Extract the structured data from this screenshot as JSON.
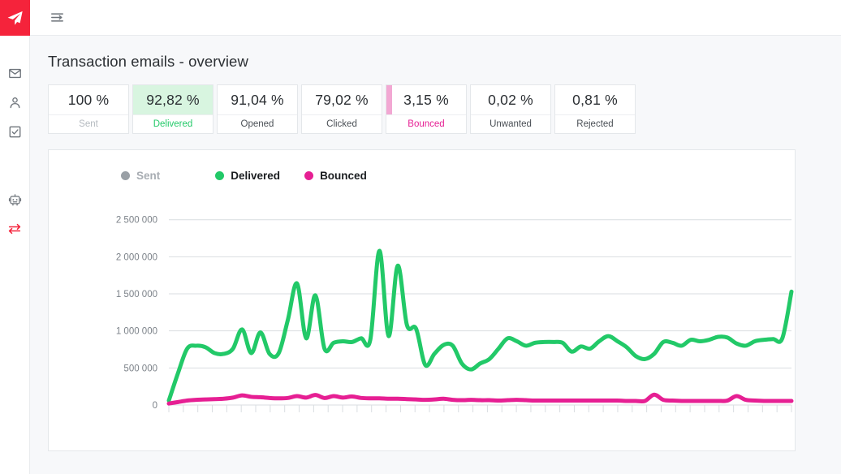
{
  "sidebar": {
    "logo_icon": "paper-plane-logo",
    "items": [
      {
        "icon": "envelope-icon",
        "name": "nav-campaigns",
        "active": false
      },
      {
        "icon": "user-icon",
        "name": "nav-contacts",
        "active": false
      },
      {
        "icon": "checkbox-list-icon",
        "name": "nav-tasks",
        "active": false
      },
      {
        "icon": "robot-icon",
        "name": "nav-automation",
        "active": false
      },
      {
        "icon": "transfer-arrows-icon",
        "name": "nav-transactional",
        "active": true
      }
    ]
  },
  "topbar": {
    "menu_icon": "hamburger-collapse-icon"
  },
  "header": {
    "title": "Transaction emails - overview"
  },
  "kpis": [
    {
      "value": "100 %",
      "label": "Sent",
      "state": "muted"
    },
    {
      "value": "92,82 %",
      "label": "Delivered",
      "state": "highlight-green"
    },
    {
      "value": "91,04 %",
      "label": "Opened",
      "state": "normal"
    },
    {
      "value": "79,02 %",
      "label": "Clicked",
      "state": "normal"
    },
    {
      "value": "3,15 %",
      "label": "Bounced",
      "state": "accent-pink"
    },
    {
      "value": "0,02 %",
      "label": "Unwanted",
      "state": "normal"
    },
    {
      "value": "0,81 %",
      "label": "Rejected",
      "state": "normal"
    }
  ],
  "colors": {
    "brand_red": "#F5233B",
    "green": "#22C968",
    "pink": "#E61F93",
    "grey": "#9AA0A6",
    "green_fill": "#D8F5E0",
    "pink_fill": "#F2A8D3"
  },
  "chart_data": {
    "type": "line",
    "title": "",
    "xlabel": "",
    "ylabel": "",
    "ylim": [
      0,
      2650000
    ],
    "yticks": [
      0,
      500000,
      1000000,
      1500000,
      2000000,
      2500000
    ],
    "ytick_labels": [
      "0",
      "500 000",
      "1 000 000",
      "1 500 000",
      "2 000 000",
      "2 500 000"
    ],
    "grid": true,
    "legend_position": "top-left",
    "x_axis_ticks_unlabeled": 44,
    "legend": [
      {
        "name": "Sent",
        "color": "#9AA0A6",
        "enabled": false
      },
      {
        "name": "Delivered",
        "color": "#22C968",
        "enabled": true
      },
      {
        "name": "Bounced",
        "color": "#E61F93",
        "enabled": true
      }
    ],
    "series": [
      {
        "name": "Delivered",
        "color": "#22C968",
        "values": [
          60000,
          430000,
          760000,
          800000,
          780000,
          700000,
          690000,
          760000,
          1020000,
          700000,
          980000,
          690000,
          700000,
          1150000,
          1640000,
          900000,
          1480000,
          760000,
          840000,
          860000,
          850000,
          900000,
          880000,
          2080000,
          930000,
          1880000,
          1080000,
          1030000,
          540000,
          690000,
          810000,
          800000,
          560000,
          480000,
          560000,
          620000,
          760000,
          900000,
          860000,
          800000,
          840000,
          850000,
          850000,
          840000,
          720000,
          790000,
          760000,
          860000,
          930000,
          860000,
          780000,
          660000,
          620000,
          690000,
          850000,
          840000,
          800000,
          880000,
          860000,
          880000,
          920000,
          910000,
          830000,
          800000,
          860000,
          880000,
          890000,
          900000,
          1530000
        ]
      },
      {
        "name": "Bounced",
        "color": "#E61F93",
        "values": [
          20000,
          40000,
          60000,
          70000,
          75000,
          80000,
          85000,
          100000,
          130000,
          110000,
          105000,
          95000,
          90000,
          95000,
          120000,
          100000,
          135000,
          95000,
          120000,
          100000,
          115000,
          95000,
          90000,
          90000,
          85000,
          85000,
          80000,
          75000,
          70000,
          75000,
          85000,
          70000,
          65000,
          70000,
          65000,
          65000,
          60000,
          65000,
          70000,
          65000,
          60000,
          60000,
          60000,
          60000,
          60000,
          60000,
          60000,
          60000,
          60000,
          60000,
          55000,
          55000,
          55000,
          140000,
          70000,
          60000,
          55000,
          55000,
          55000,
          55000,
          55000,
          60000,
          120000,
          70000,
          60000,
          55000,
          55000,
          55000,
          55000
        ]
      }
    ]
  }
}
